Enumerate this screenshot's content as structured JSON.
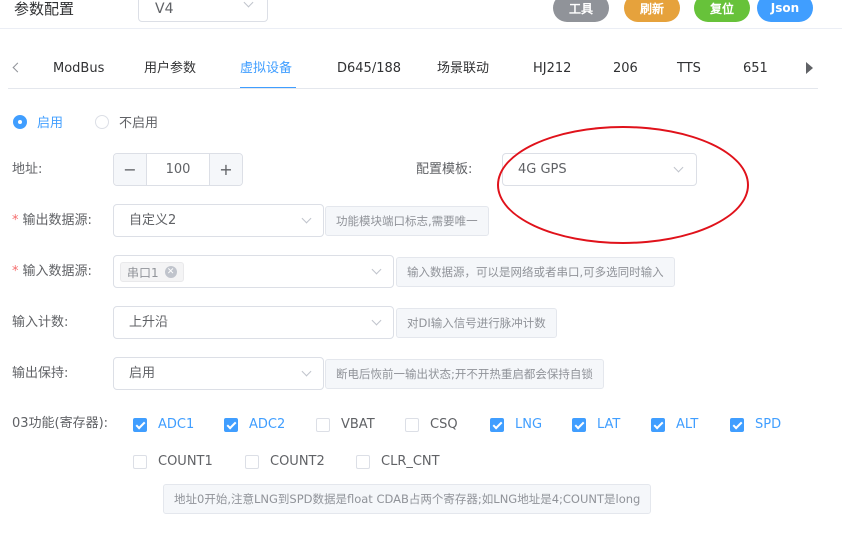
{
  "header": {
    "title": "参数配置",
    "version": "V4",
    "buttons": {
      "tools": "工具",
      "refresh": "刷新",
      "reset": "复位",
      "json": "Json"
    }
  },
  "tabs": [
    {
      "label": "ModBus",
      "active": false
    },
    {
      "label": "用户参数",
      "active": false
    },
    {
      "label": "虚拟设备",
      "active": true
    },
    {
      "label": "D645/188",
      "active": false
    },
    {
      "label": "场景联动",
      "active": false
    },
    {
      "label": "HJ212",
      "active": false
    },
    {
      "label": "206",
      "active": false
    },
    {
      "label": "TTS",
      "active": false
    },
    {
      "label": "651",
      "active": false
    }
  ],
  "enable": {
    "on_label": "启用",
    "off_label": "不启用",
    "selected": "启用"
  },
  "form": {
    "address": {
      "label": "地址:",
      "value": "100",
      "minus": "−",
      "plus": "+"
    },
    "template": {
      "label": "配置模板:",
      "value": "4G GPS"
    },
    "output_source": {
      "required": "*",
      "label": "输出数据源:",
      "value": "自定义2",
      "hint": "功能模块端口标志,需要唯一"
    },
    "input_source": {
      "required": "*",
      "label": "输入数据源:",
      "tag": "串口1",
      "hint": "输入数据源，可以是网络或者串口,可多选同时输入"
    },
    "input_count": {
      "label": "输入计数:",
      "value": "上升沿",
      "hint": "对DI输入信号进行脉冲计数"
    },
    "output_hold": {
      "label": "输出保持:",
      "value": "启用",
      "hint": "断电后恢前一输出状态;开不开热重启都会保持自锁"
    },
    "func03": {
      "label": "03功能(寄存器):",
      "checks": [
        {
          "label": "ADC1",
          "checked": true
        },
        {
          "label": "ADC2",
          "checked": true
        },
        {
          "label": "VBAT",
          "checked": false
        },
        {
          "label": "CSQ",
          "checked": false
        },
        {
          "label": "LNG",
          "checked": true
        },
        {
          "label": "LAT",
          "checked": true
        },
        {
          "label": "ALT",
          "checked": true
        },
        {
          "label": "SPD",
          "checked": true
        },
        {
          "label": "COUNT1",
          "checked": false
        },
        {
          "label": "COUNT2",
          "checked": false
        },
        {
          "label": "CLR_CNT",
          "checked": false
        }
      ],
      "hint": "地址0开始,注意LNG到SPD数据是float CDAB占两个寄存器;如LNG地址是4;COUNT是long"
    }
  },
  "colors": {
    "primary": "#409eff",
    "tools": "#909399",
    "refresh": "#e6a23c",
    "reset": "#67c23a",
    "annotation": "#e0121b"
  }
}
